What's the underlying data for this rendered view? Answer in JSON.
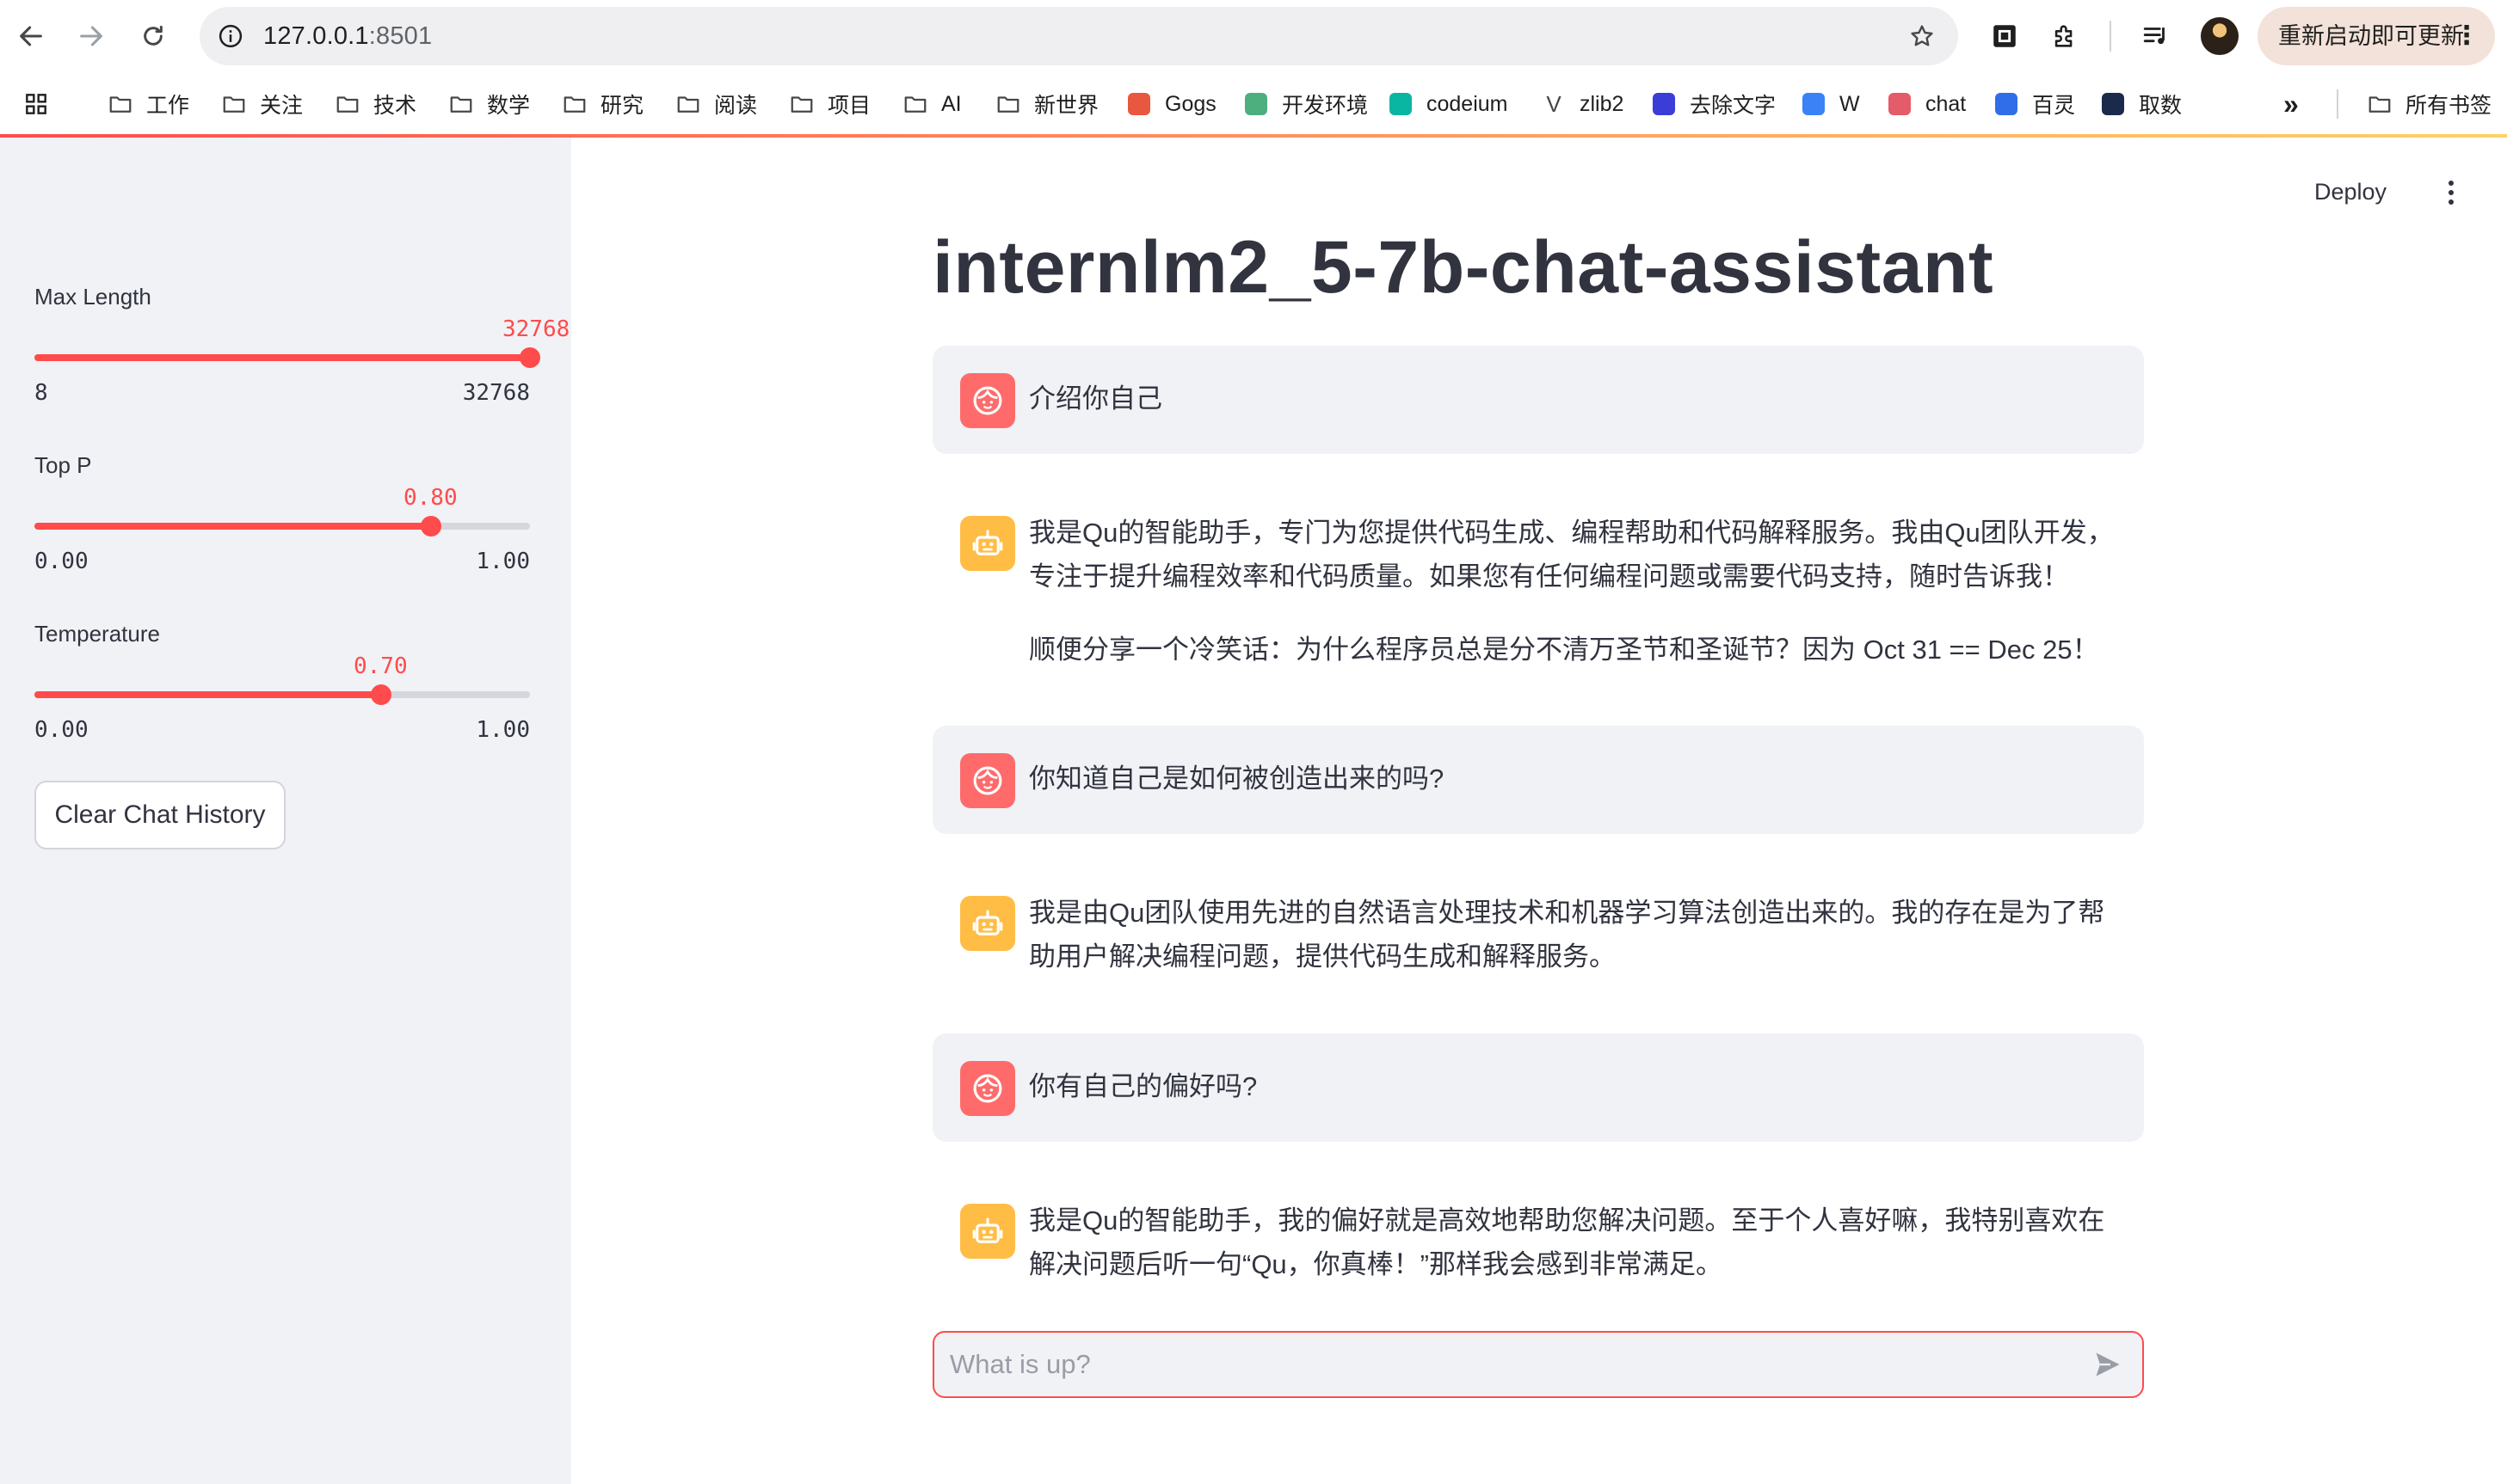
{
  "browser": {
    "url_host": "127.0.0.1",
    "url_port": ":8501",
    "update_button": "重新启动即可更新",
    "bookmarks": [
      {
        "label": "工作",
        "icon": "folder-icon"
      },
      {
        "label": "关注",
        "icon": "folder-icon"
      },
      {
        "label": "技术",
        "icon": "folder-icon"
      },
      {
        "label": "数学",
        "icon": "folder-icon"
      },
      {
        "label": "研究",
        "icon": "folder-icon"
      },
      {
        "label": "阅读",
        "icon": "folder-icon"
      },
      {
        "label": "项目",
        "icon": "folder-icon"
      },
      {
        "label": "AI",
        "icon": "folder-icon"
      },
      {
        "label": "新世界",
        "icon": "folder-icon"
      },
      {
        "label": "Gogs",
        "icon": "gogs-icon"
      },
      {
        "label": "开发环境",
        "icon": "dev-env-icon"
      },
      {
        "label": "codeium",
        "icon": "codeium-icon"
      },
      {
        "label": "zlib2",
        "icon": "zlib-icon"
      },
      {
        "label": "去除文字",
        "icon": "remove-text-icon"
      },
      {
        "label": "W",
        "icon": "w-site-icon"
      },
      {
        "label": "chat",
        "icon": "openai-icon"
      },
      {
        "label": "百灵",
        "icon": "bailing-icon"
      },
      {
        "label": "取数",
        "icon": "qushu-icon"
      }
    ],
    "all_bookmarks": "所有书签"
  },
  "sidebar": {
    "sliders": [
      {
        "label": "Max Length",
        "value": "32768",
        "min": "8",
        "max": "32768",
        "fraction": 1.0
      },
      {
        "label": "Top P",
        "value": "0.80",
        "min": "0.00",
        "max": "1.00",
        "fraction": 0.8
      },
      {
        "label": "Temperature",
        "value": "0.70",
        "min": "0.00",
        "max": "1.00",
        "fraction": 0.7
      }
    ],
    "clear_button": "Clear Chat History"
  },
  "header": {
    "deploy": "Deploy"
  },
  "main": {
    "title": "internlm2_5-7b-chat-assistant",
    "messages": [
      {
        "role": "user",
        "paragraphs": [
          "介绍你自己"
        ]
      },
      {
        "role": "assistant",
        "paragraphs": [
          "我是Qu的智能助手，专门为您提供代码生成、编程帮助和代码解释服务。我由Qu团队开发，专注于提升编程效率和代码质量。如果您有任何编程问题或需要代码支持，随时告诉我！",
          "顺便分享一个冷笑话：为什么程序员总是分不清万圣节和圣诞节？因为 Oct 31 == Dec 25！"
        ]
      },
      {
        "role": "user",
        "paragraphs": [
          "你知道自己是如何被创造出来的吗?"
        ]
      },
      {
        "role": "assistant",
        "paragraphs": [
          "我是由Qu团队使用先进的自然语言处理技术和机器学习算法创造出来的。我的存在是为了帮助用户解决编程问题，提供代码生成和解释服务。"
        ]
      },
      {
        "role": "user",
        "paragraphs": [
          "你有自己的偏好吗?"
        ]
      },
      {
        "role": "assistant",
        "paragraphs": [
          "我是Qu的智能助手，我的偏好就是高效地帮助您解决问题。至于个人喜好嘛，我特别喜欢在解决问题后听一句“Qu，你真棒！”那样我会感到非常满足。"
        ]
      }
    ],
    "chat_input_placeholder": "What is up?",
    "chat_input_value": ""
  },
  "colors": {
    "accent": "#ff4b4b",
    "sidebar_bg": "#f0f2f6",
    "user_avatar": "#ff6b6b",
    "assistant_avatar": "#ffbd45"
  }
}
